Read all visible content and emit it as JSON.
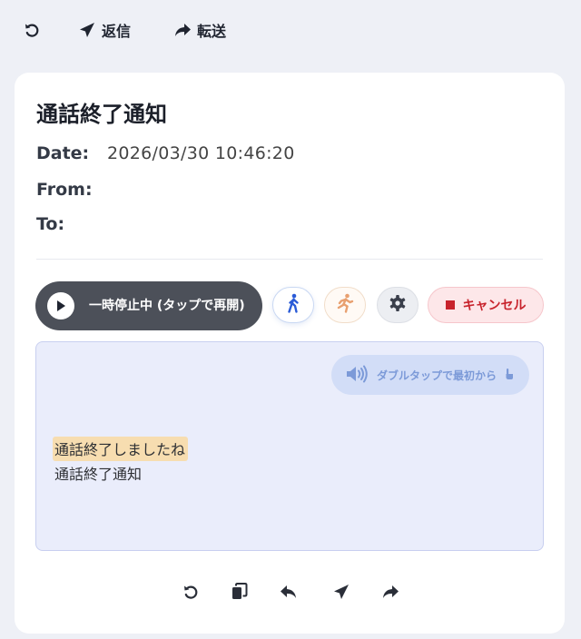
{
  "toolbar": {
    "refresh_icon": "refresh-icon",
    "reply_label": "返信",
    "forward_label": "転送"
  },
  "message": {
    "subject": "通話終了通知",
    "date_label": "Date:",
    "date_value": "2026/03/30 10:46:20",
    "from_label": "From:",
    "from_value": "",
    "to_label": "To:",
    "to_value": ""
  },
  "player": {
    "status_label": "一時停止中 (タップで再開)",
    "speed_slow_icon": "walk-icon",
    "speed_fast_icon": "run-icon",
    "settings_icon": "gear-icon",
    "cancel_label": "キャンセル"
  },
  "reader": {
    "replay_label": "ダブルタップで最初から",
    "highlighted_line": "通話終了しましたね",
    "body_line": "通話終了通知"
  },
  "bottom_actions": [
    "refresh-icon",
    "copy-icon",
    "reply-icon",
    "send-icon",
    "forward-icon"
  ],
  "colors": {
    "background": "#eef0f6",
    "card": "#ffffff",
    "player_pill": "#4c5059",
    "cancel_text": "#c8232c",
    "cancel_bg": "#fde7e9",
    "reader_bg": "#eaedfb",
    "highlight": "#f7ddb0",
    "walk_icon": "#2a5bd7",
    "run_icon": "#e8a070"
  }
}
